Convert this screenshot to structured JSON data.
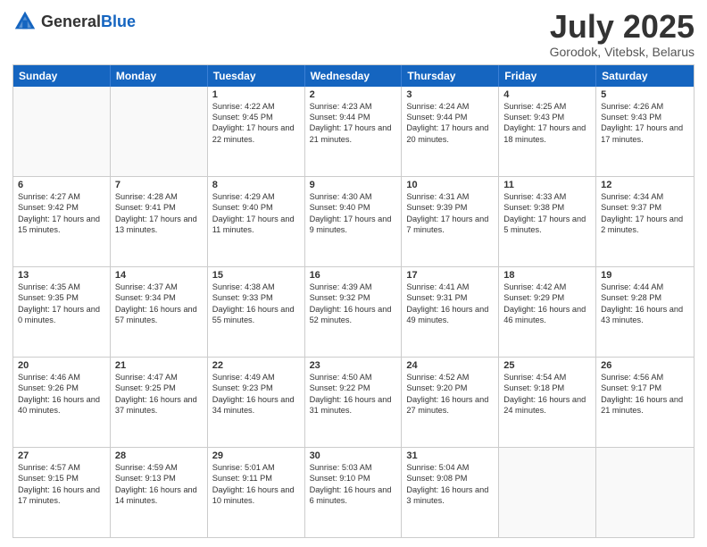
{
  "header": {
    "logo_general": "General",
    "logo_blue": "Blue",
    "title": "July 2025",
    "location": "Gorodok, Vitebsk, Belarus"
  },
  "days_of_week": [
    "Sunday",
    "Monday",
    "Tuesday",
    "Wednesday",
    "Thursday",
    "Friday",
    "Saturday"
  ],
  "rows": [
    [
      {
        "day": "",
        "empty": true
      },
      {
        "day": "",
        "empty": true
      },
      {
        "day": "1",
        "sunrise": "Sunrise: 4:22 AM",
        "sunset": "Sunset: 9:45 PM",
        "daylight": "Daylight: 17 hours and 22 minutes."
      },
      {
        "day": "2",
        "sunrise": "Sunrise: 4:23 AM",
        "sunset": "Sunset: 9:44 PM",
        "daylight": "Daylight: 17 hours and 21 minutes."
      },
      {
        "day": "3",
        "sunrise": "Sunrise: 4:24 AM",
        "sunset": "Sunset: 9:44 PM",
        "daylight": "Daylight: 17 hours and 20 minutes."
      },
      {
        "day": "4",
        "sunrise": "Sunrise: 4:25 AM",
        "sunset": "Sunset: 9:43 PM",
        "daylight": "Daylight: 17 hours and 18 minutes."
      },
      {
        "day": "5",
        "sunrise": "Sunrise: 4:26 AM",
        "sunset": "Sunset: 9:43 PM",
        "daylight": "Daylight: 17 hours and 17 minutes."
      }
    ],
    [
      {
        "day": "6",
        "sunrise": "Sunrise: 4:27 AM",
        "sunset": "Sunset: 9:42 PM",
        "daylight": "Daylight: 17 hours and 15 minutes."
      },
      {
        "day": "7",
        "sunrise": "Sunrise: 4:28 AM",
        "sunset": "Sunset: 9:41 PM",
        "daylight": "Daylight: 17 hours and 13 minutes."
      },
      {
        "day": "8",
        "sunrise": "Sunrise: 4:29 AM",
        "sunset": "Sunset: 9:40 PM",
        "daylight": "Daylight: 17 hours and 11 minutes."
      },
      {
        "day": "9",
        "sunrise": "Sunrise: 4:30 AM",
        "sunset": "Sunset: 9:40 PM",
        "daylight": "Daylight: 17 hours and 9 minutes."
      },
      {
        "day": "10",
        "sunrise": "Sunrise: 4:31 AM",
        "sunset": "Sunset: 9:39 PM",
        "daylight": "Daylight: 17 hours and 7 minutes."
      },
      {
        "day": "11",
        "sunrise": "Sunrise: 4:33 AM",
        "sunset": "Sunset: 9:38 PM",
        "daylight": "Daylight: 17 hours and 5 minutes."
      },
      {
        "day": "12",
        "sunrise": "Sunrise: 4:34 AM",
        "sunset": "Sunset: 9:37 PM",
        "daylight": "Daylight: 17 hours and 2 minutes."
      }
    ],
    [
      {
        "day": "13",
        "sunrise": "Sunrise: 4:35 AM",
        "sunset": "Sunset: 9:35 PM",
        "daylight": "Daylight: 17 hours and 0 minutes."
      },
      {
        "day": "14",
        "sunrise": "Sunrise: 4:37 AM",
        "sunset": "Sunset: 9:34 PM",
        "daylight": "Daylight: 16 hours and 57 minutes."
      },
      {
        "day": "15",
        "sunrise": "Sunrise: 4:38 AM",
        "sunset": "Sunset: 9:33 PM",
        "daylight": "Daylight: 16 hours and 55 minutes."
      },
      {
        "day": "16",
        "sunrise": "Sunrise: 4:39 AM",
        "sunset": "Sunset: 9:32 PM",
        "daylight": "Daylight: 16 hours and 52 minutes."
      },
      {
        "day": "17",
        "sunrise": "Sunrise: 4:41 AM",
        "sunset": "Sunset: 9:31 PM",
        "daylight": "Daylight: 16 hours and 49 minutes."
      },
      {
        "day": "18",
        "sunrise": "Sunrise: 4:42 AM",
        "sunset": "Sunset: 9:29 PM",
        "daylight": "Daylight: 16 hours and 46 minutes."
      },
      {
        "day": "19",
        "sunrise": "Sunrise: 4:44 AM",
        "sunset": "Sunset: 9:28 PM",
        "daylight": "Daylight: 16 hours and 43 minutes."
      }
    ],
    [
      {
        "day": "20",
        "sunrise": "Sunrise: 4:46 AM",
        "sunset": "Sunset: 9:26 PM",
        "daylight": "Daylight: 16 hours and 40 minutes."
      },
      {
        "day": "21",
        "sunrise": "Sunrise: 4:47 AM",
        "sunset": "Sunset: 9:25 PM",
        "daylight": "Daylight: 16 hours and 37 minutes."
      },
      {
        "day": "22",
        "sunrise": "Sunrise: 4:49 AM",
        "sunset": "Sunset: 9:23 PM",
        "daylight": "Daylight: 16 hours and 34 minutes."
      },
      {
        "day": "23",
        "sunrise": "Sunrise: 4:50 AM",
        "sunset": "Sunset: 9:22 PM",
        "daylight": "Daylight: 16 hours and 31 minutes."
      },
      {
        "day": "24",
        "sunrise": "Sunrise: 4:52 AM",
        "sunset": "Sunset: 9:20 PM",
        "daylight": "Daylight: 16 hours and 27 minutes."
      },
      {
        "day": "25",
        "sunrise": "Sunrise: 4:54 AM",
        "sunset": "Sunset: 9:18 PM",
        "daylight": "Daylight: 16 hours and 24 minutes."
      },
      {
        "day": "26",
        "sunrise": "Sunrise: 4:56 AM",
        "sunset": "Sunset: 9:17 PM",
        "daylight": "Daylight: 16 hours and 21 minutes."
      }
    ],
    [
      {
        "day": "27",
        "sunrise": "Sunrise: 4:57 AM",
        "sunset": "Sunset: 9:15 PM",
        "daylight": "Daylight: 16 hours and 17 minutes."
      },
      {
        "day": "28",
        "sunrise": "Sunrise: 4:59 AM",
        "sunset": "Sunset: 9:13 PM",
        "daylight": "Daylight: 16 hours and 14 minutes."
      },
      {
        "day": "29",
        "sunrise": "Sunrise: 5:01 AM",
        "sunset": "Sunset: 9:11 PM",
        "daylight": "Daylight: 16 hours and 10 minutes."
      },
      {
        "day": "30",
        "sunrise": "Sunrise: 5:03 AM",
        "sunset": "Sunset: 9:10 PM",
        "daylight": "Daylight: 16 hours and 6 minutes."
      },
      {
        "day": "31",
        "sunrise": "Sunrise: 5:04 AM",
        "sunset": "Sunset: 9:08 PM",
        "daylight": "Daylight: 16 hours and 3 minutes."
      },
      {
        "day": "",
        "empty": true
      },
      {
        "day": "",
        "empty": true
      }
    ]
  ]
}
